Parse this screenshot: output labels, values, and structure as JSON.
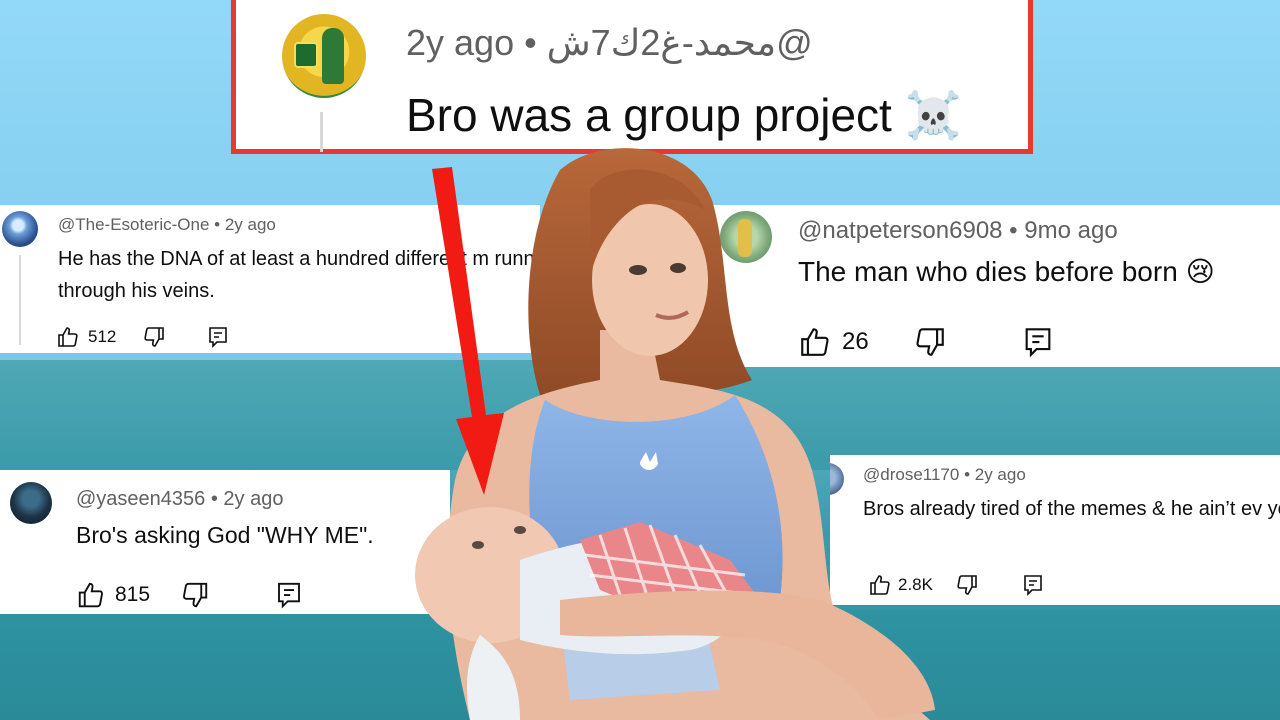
{
  "highlight": {
    "handle": "@محمد-غ2ك7ش",
    "separator": " • ",
    "age": "2y ago",
    "text": "Bro was a group project",
    "emoji": "☠️",
    "border_color": "#e8392f"
  },
  "comments": [
    {
      "handle": "@The-Esoteric-One",
      "age": "2y ago",
      "text": "He has the DNA of at least a hundred different m running through his veins.",
      "likes": "512"
    },
    {
      "handle": "@natpeterson6908",
      "age": "9mo ago",
      "text": "The man who dies before born",
      "emoji": "😢",
      "likes": "26"
    },
    {
      "handle": "@yaseen4356",
      "age": "2y ago",
      "text": "Bro's asking God \"WHY ME\".",
      "likes": "815"
    },
    {
      "handle": "@drose1170",
      "age": "2y ago",
      "text": "Bros already tired of the memes & he ain’t ev yet.",
      "likes": "2.8K"
    }
  ],
  "icons": [
    "like-icon",
    "dislike-icon",
    "reply-icon",
    "skull-emoji",
    "crying-emoji"
  ],
  "colors": {
    "arrow": "#f21b14",
    "meta_text": "#606060",
    "card": "#ffffff"
  }
}
